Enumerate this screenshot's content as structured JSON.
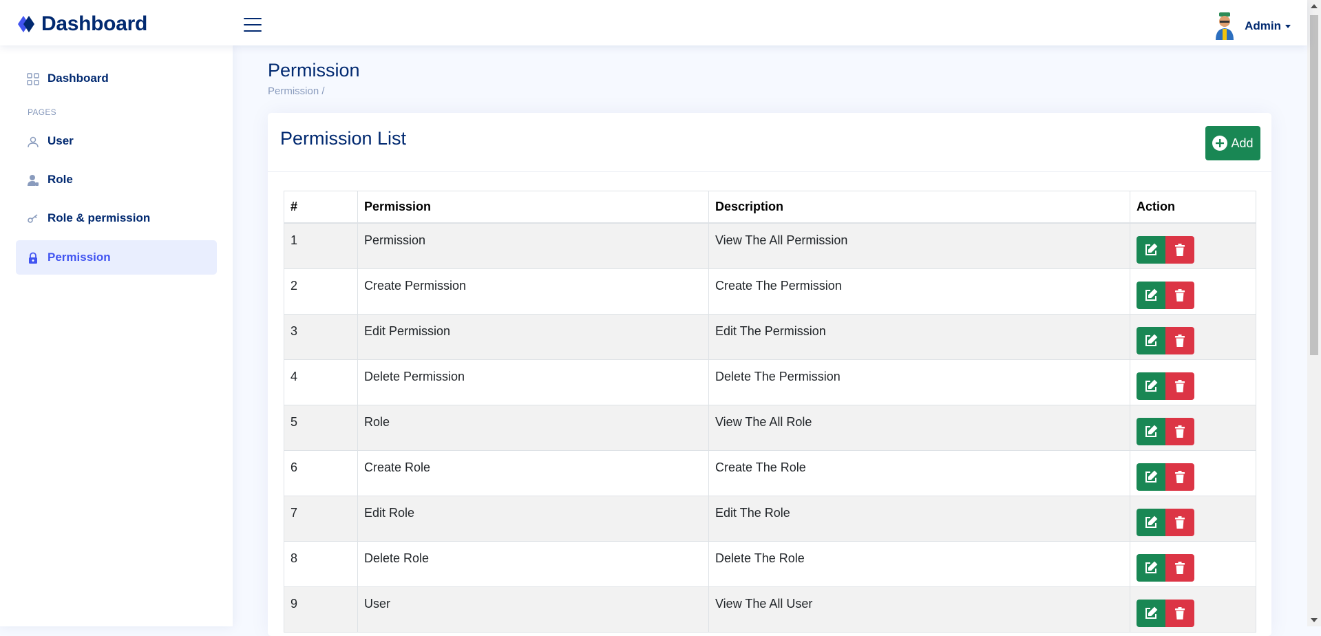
{
  "header": {
    "logo_text": "Dashboard",
    "logo_icon": "diamond-logo-icon",
    "menu_icon": "hamburger-icon",
    "profile_name": "Admin"
  },
  "sidebar": {
    "heading": "PAGES",
    "items": [
      {
        "label": "Dashboard",
        "icon": "grid-icon"
      },
      {
        "label": "User",
        "icon": "person-icon"
      },
      {
        "label": "Role",
        "icon": "person-badge-icon"
      },
      {
        "label": "Role & permission",
        "icon": "key-icon"
      },
      {
        "label": "Permission",
        "icon": "lock-icon",
        "active": true
      }
    ]
  },
  "main": {
    "page_title": "Permission",
    "breadcrumb": "Permission /",
    "card_title": "Permission List",
    "add_label": "Add",
    "table": {
      "headers": [
        "#",
        "Permission",
        "Description",
        "Action"
      ],
      "rows": [
        {
          "no": "1",
          "permission": "Permission",
          "description": "View The All Permission"
        },
        {
          "no": "2",
          "permission": "Create Permission",
          "description": "Create The Permission"
        },
        {
          "no": "3",
          "permission": "Edit Permission",
          "description": "Edit The Permission"
        },
        {
          "no": "4",
          "permission": "Delete Permission",
          "description": "Delete The Permission"
        },
        {
          "no": "5",
          "permission": "Role",
          "description": "View The All Role"
        },
        {
          "no": "6",
          "permission": "Create Role",
          "description": "Create The Role"
        },
        {
          "no": "7",
          "permission": "Edit Role",
          "description": "Edit The Role"
        },
        {
          "no": "8",
          "permission": "Delete Role",
          "description": "Delete The Role"
        },
        {
          "no": "9",
          "permission": "User",
          "description": "View The All User"
        }
      ]
    }
  },
  "colors": {
    "primary": "#012970",
    "accent": "#4154f1",
    "success": "#198754",
    "danger": "#dc3545"
  }
}
